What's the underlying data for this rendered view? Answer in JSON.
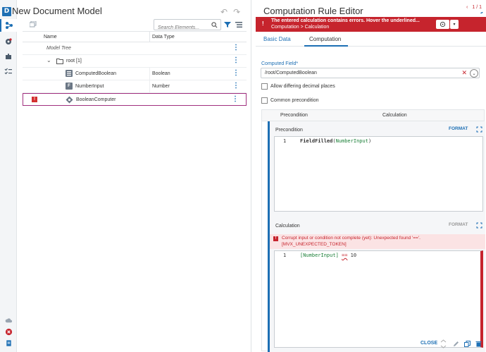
{
  "left": {
    "title": "New Document Model",
    "search_placeholder": "Search Elements...",
    "columns": {
      "name": "Name",
      "data_type": "Data Type"
    },
    "model_tree_label": "Model Tree",
    "rows": [
      {
        "label": "root [1]",
        "type": ""
      },
      {
        "label": "ComputedBoolean",
        "type": "Boolean",
        "icon_letter": ""
      },
      {
        "label": "NumberInput",
        "type": "Number",
        "icon_letter": "F"
      },
      {
        "label": "BooleanComputer",
        "type": "",
        "error_mark": "!"
      }
    ]
  },
  "right": {
    "title": "Computation Rule Editor",
    "error_banner": {
      "icon": "!",
      "message": "The entered calculation contains errors. Hover the underlined...",
      "path": "Computation > Calculation",
      "counter": "1 / 1"
    },
    "tabs": [
      "Basic Data",
      "Computation"
    ],
    "active_tab": "Computation",
    "computed_field_label": "Computed Field*",
    "computed_field_value": "/root/ComputedBoolean",
    "checkboxes": [
      "Allow differing decimal places",
      "Common precondition"
    ],
    "cond_columns": [
      "Precondition",
      "Calculation"
    ],
    "precondition": {
      "title": "Precondition",
      "format_label": "FORMAT",
      "line_no": "1",
      "code_fn": "FieldFilled",
      "code_paren_open": "(",
      "code_arg": "NumberInput",
      "code_paren_close": ")"
    },
    "calculation": {
      "title": "Calculation",
      "format_label": "FORMAT",
      "error_line1": "Corrupt input or condition not complete (yet): Unexpected found '=='.",
      "error_line2": "[MVX_UNEXPECTED_TOKEN]",
      "line_no": "1",
      "code_field": "[NumberInput]",
      "code_op": "==",
      "code_num": "10"
    },
    "footer": {
      "close_label": "CLOSE"
    }
  },
  "colors": {
    "accent": "#1d6fb4",
    "error": "#c6242d",
    "selected_border": "#a1307f"
  }
}
